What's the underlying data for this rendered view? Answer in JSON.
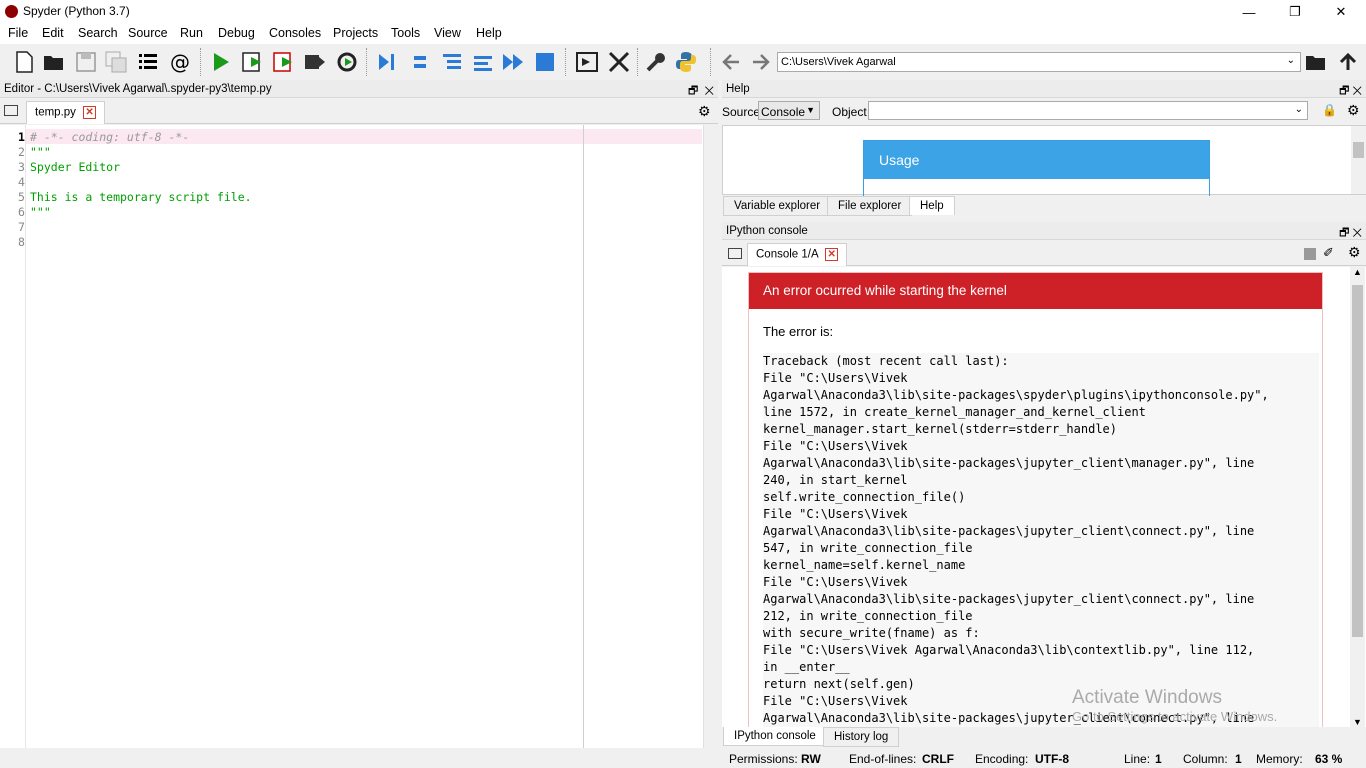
{
  "window": {
    "title": "Spyder (Python 3.7)"
  },
  "menu": [
    "File",
    "Edit",
    "Search",
    "Source",
    "Run",
    "Debug",
    "Consoles",
    "Projects",
    "Tools",
    "View",
    "Help"
  ],
  "toolbar": {
    "path_value": "C:\\Users\\Vivek Agarwal"
  },
  "editor": {
    "header": "Editor - C:\\Users\\Vivek Agarwal\\.spyder-py3\\temp.py",
    "tab": "temp.py",
    "lines": [
      {
        "n": "1",
        "text": "# -*- coding: utf-8 -*-"
      },
      {
        "n": "2",
        "text": "\"\"\""
      },
      {
        "n": "3",
        "text": "Spyder Editor"
      },
      {
        "n": "4",
        "text": ""
      },
      {
        "n": "5",
        "text": "This is a temporary script file."
      },
      {
        "n": "6",
        "text": "\"\"\""
      },
      {
        "n": "7",
        "text": ""
      },
      {
        "n": "8",
        "text": ""
      }
    ]
  },
  "help": {
    "header": "Help",
    "source_label": "Source",
    "source_value": "Console",
    "object_label": "Object",
    "usage_title": "Usage",
    "tabs": [
      "Variable explorer",
      "File explorer",
      "Help"
    ]
  },
  "console": {
    "header": "IPython console",
    "tab": "Console 1/A",
    "error_title": "An error ocurred while starting the kernel",
    "error_intro": "The error is:",
    "traceback": [
      "Traceback (most recent call last):",
      "File \"C:\\Users\\Vivek",
      "Agarwal\\Anaconda3\\lib\\site-packages\\spyder\\plugins\\ipythonconsole.py\",",
      "line 1572, in create_kernel_manager_and_kernel_client",
      "kernel_manager.start_kernel(stderr=stderr_handle)",
      "File \"C:\\Users\\Vivek",
      "Agarwal\\Anaconda3\\lib\\site-packages\\jupyter_client\\manager.py\", line",
      "240, in start_kernel",
      "self.write_connection_file()",
      "File \"C:\\Users\\Vivek",
      "Agarwal\\Anaconda3\\lib\\site-packages\\jupyter_client\\connect.py\", line",
      "547, in write_connection_file",
      "kernel_name=self.kernel_name",
      "File \"C:\\Users\\Vivek",
      "Agarwal\\Anaconda3\\lib\\site-packages\\jupyter_client\\connect.py\", line",
      "212, in write_connection_file",
      "with secure_write(fname) as f:",
      "File \"C:\\Users\\Vivek Agarwal\\Anaconda3\\lib\\contextlib.py\", line 112,",
      "in __enter__",
      "return next(self.gen)",
      "File \"C:\\Users\\Vivek",
      "Agarwal\\Anaconda3\\lib\\site-packages\\jupyter_client\\connect.py\", line"
    ],
    "bottom_tabs": [
      "IPython console",
      "History log"
    ]
  },
  "watermark": {
    "line1": "Activate Windows",
    "line2": "Go to Settings to activate Windows."
  },
  "status": {
    "permissions_label": "Permissions:",
    "permissions_value": "RW",
    "eol_label": "End-of-lines:",
    "eol_value": "CRLF",
    "encoding_label": "Encoding:",
    "encoding_value": "UTF-8",
    "line_label": "Line:",
    "line_value": "1",
    "column_label": "Column:",
    "column_value": "1",
    "memory_label": "Memory:",
    "memory_value": "63 %"
  }
}
